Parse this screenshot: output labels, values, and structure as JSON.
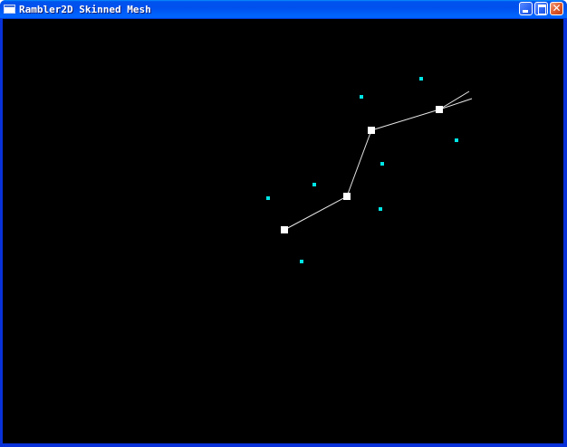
{
  "window": {
    "title": "Rambler2D Skinned Mesh"
  },
  "icons": {
    "app": "app-window-icon",
    "minimize": "minimize-icon",
    "maximize": "maximize-icon",
    "close": "close-icon"
  },
  "colors": {
    "titlebar": "#0054e3",
    "canvas_background": "#000000",
    "bone": "#ffffff",
    "joint": "#ffffff",
    "vertex": "#00e5e5"
  }
}
